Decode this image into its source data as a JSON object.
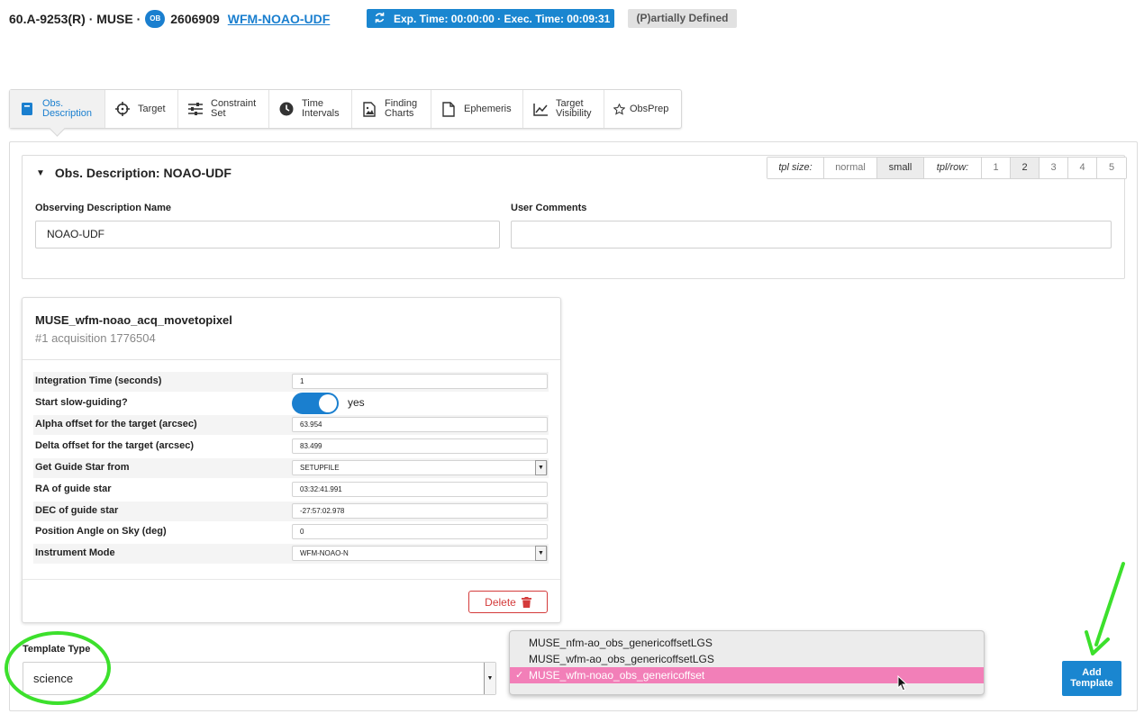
{
  "header": {
    "program": "60.A-9253(R) · MUSE ·",
    "ob_badge": "OB",
    "ob_id": "2606909",
    "ob_name": "WFM-NOAO-UDF",
    "time_badge": "Exp. Time: 00:00:00 · Exec. Time: 00:09:31",
    "status": "(P)artially Defined"
  },
  "tabs": [
    {
      "l1": "Obs.",
      "l2": "Description",
      "icon": "book-icon"
    },
    {
      "l1": "Target",
      "l2": "",
      "icon": "crosshair-icon"
    },
    {
      "l1": "Constraint",
      "l2": "Set",
      "icon": "sliders-icon"
    },
    {
      "l1": "Time",
      "l2": "Intervals",
      "icon": "clock-icon"
    },
    {
      "l1": "Finding",
      "l2": "Charts",
      "icon": "image-file-icon"
    },
    {
      "l1": "Ephemeris",
      "l2": "",
      "icon": "file-icon"
    },
    {
      "l1": "Target",
      "l2": "Visibility",
      "icon": "line-chart-icon"
    },
    {
      "l1": "ObsPrep",
      "l2": "",
      "icon": "star-icon"
    }
  ],
  "description": {
    "title": "Obs. Description: NOAO-UDF",
    "tpl_size_label": "tpl size:",
    "size_normal": "normal",
    "size_small": "small",
    "tpl_row_label": "tpl/row:",
    "rows": [
      "1",
      "2",
      "3",
      "4",
      "5"
    ],
    "name_label": "Observing Description Name",
    "name_value": "NOAO-UDF",
    "comments_label": "User Comments",
    "comments_value": ""
  },
  "template": {
    "title": "MUSE_wfm-noao_acq_movetopixel",
    "subtitle": "#1 acquisition 1776504",
    "params": [
      {
        "label": "Integration Time (seconds)",
        "value": "1"
      },
      {
        "label": "Start slow-guiding?",
        "value": "yes"
      },
      {
        "label": "Alpha offset for the target (arcsec)",
        "value": "63.954"
      },
      {
        "label": "Delta offset for the target (arcsec)",
        "value": "83.499"
      },
      {
        "label": "Get Guide Star from",
        "value": "SETUPFILE"
      },
      {
        "label": "RA of guide star",
        "value": "03:32:41.991"
      },
      {
        "label": "DEC of guide star",
        "value": "-27:57:02.978"
      },
      {
        "label": "Position Angle on Sky (deg)",
        "value": "0"
      },
      {
        "label": "Instrument Mode",
        "value": "WFM-NOAO-N"
      }
    ],
    "delete_label": "Delete"
  },
  "template_type": {
    "label": "Template Type",
    "value": "science"
  },
  "dropdown": {
    "options": [
      "MUSE_nfm-ao_obs_genericoffsetLGS",
      "MUSE_wfm-ao_obs_genericoffsetLGS",
      "MUSE_wfm-noao_obs_genericoffset"
    ],
    "selected_index": 2,
    "check": "✓"
  },
  "add_template": {
    "l1": "Add",
    "l2": "Template"
  },
  "colors": {
    "accent": "#1a7fcf",
    "annotation": "#3ce02c",
    "selection": "#f27fb8",
    "danger": "#d43b3b"
  }
}
